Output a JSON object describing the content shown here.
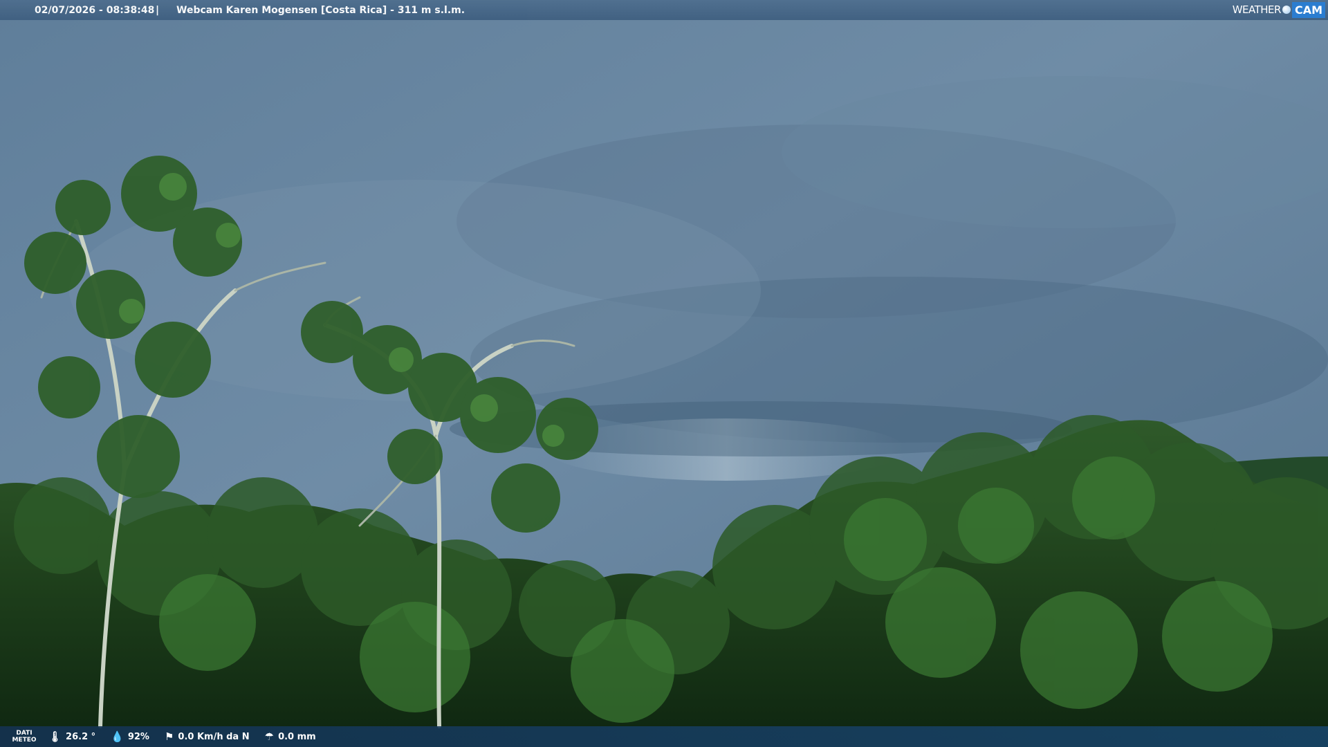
{
  "header": {
    "datetime": "02/07/2026 - 08:38:48",
    "separator": "|",
    "title": "Webcam Karen Mogensen [Costa Rica]  - 311 m s.l.m."
  },
  "brand": {
    "weather": "WEATHER",
    "cam": "CAM"
  },
  "footer": {
    "label_line1": "DATI",
    "label_line2": "METEO",
    "temperature": "26.2 °",
    "humidity": "92%",
    "wind": "0.0 Km/h da N",
    "rain": "0.0 mm"
  },
  "icons": {
    "temperature": "thermometer-icon",
    "humidity": "humidity-icon",
    "wind": "wind-icon",
    "rain": "rain-icon"
  }
}
